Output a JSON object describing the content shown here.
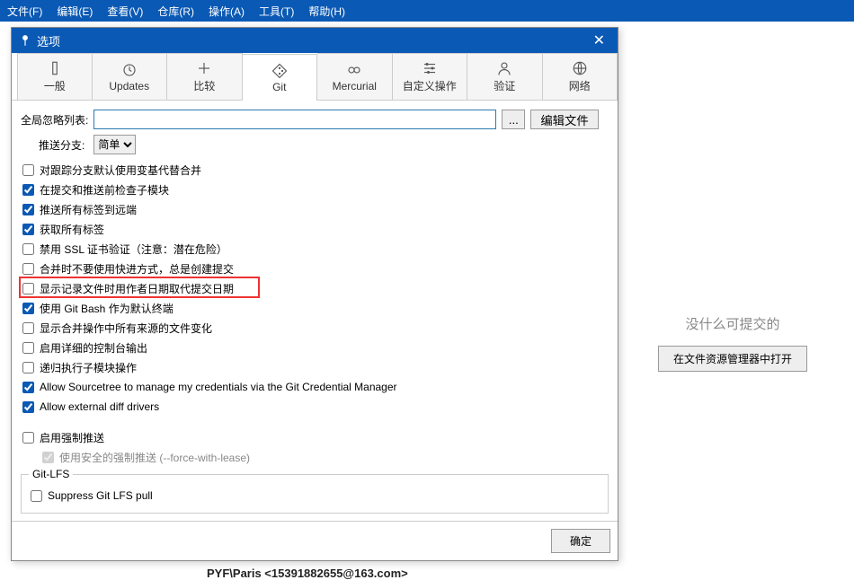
{
  "menubar": [
    "文件(F)",
    "编辑(E)",
    "查看(V)",
    "仓库(R)",
    "操作(A)",
    "工具(T)",
    "帮助(H)"
  ],
  "rightPanel": {
    "msg": "没什么可提交的",
    "button": "在文件资源管理器中打开"
  },
  "footerLine": "PYF\\Paris <15391882655@163.com>",
  "dialog": {
    "title": "选项",
    "tabs": [
      {
        "id": "general",
        "label": "一般"
      },
      {
        "id": "updates",
        "label": "Updates"
      },
      {
        "id": "compare",
        "label": "比较"
      },
      {
        "id": "git",
        "label": "Git"
      },
      {
        "id": "mercurial",
        "label": "Mercurial"
      },
      {
        "id": "custom",
        "label": "自定义操作"
      },
      {
        "id": "auth",
        "label": "验证"
      },
      {
        "id": "network",
        "label": "网络"
      }
    ],
    "activeTab": "git",
    "globalIgnoreLabel": "全局忽略列表:",
    "globalIgnoreValue": "",
    "dotsLabel": "...",
    "editFileLabel": "编辑文件",
    "pushBranchLabel": "推送分支:",
    "pushBranchValue": "简单",
    "checkboxes": [
      {
        "label": "对跟踪分支默认使用变基代替合并",
        "checked": false
      },
      {
        "label": "在提交和推送前检查子模块",
        "checked": true
      },
      {
        "label": "推送所有标签到远端",
        "checked": true
      },
      {
        "label": "获取所有标签",
        "checked": true
      },
      {
        "label": "禁用 SSL 证书验证（注意：潜在危险）",
        "checked": false,
        "highlighted": true
      },
      {
        "label": "合并时不要使用快进方式，总是创建提交",
        "checked": false
      },
      {
        "label": "显示记录文件时用作者日期取代提交日期",
        "checked": false
      },
      {
        "label": "使用 Git Bash 作为默认终端",
        "checked": true
      },
      {
        "label": "显示合并操作中所有来源的文件变化",
        "checked": false
      },
      {
        "label": "启用详细的控制台输出",
        "checked": false
      },
      {
        "label": "递归执行子模块操作",
        "checked": false
      },
      {
        "label": "Allow Sourcetree to manage my credentials via the Git Credential Manager",
        "checked": true
      },
      {
        "label": "Allow external diff drivers",
        "checked": true
      }
    ],
    "forcePush": {
      "label": "启用强制推送",
      "checked": false,
      "subLabel": "使用安全的强制推送 (--force-with-lease)",
      "subChecked": true
    },
    "gitLfs": {
      "legend": "Git-LFS",
      "suppressLabel": "Suppress Git LFS pull",
      "suppressChecked": false
    },
    "okButton": "确定"
  }
}
